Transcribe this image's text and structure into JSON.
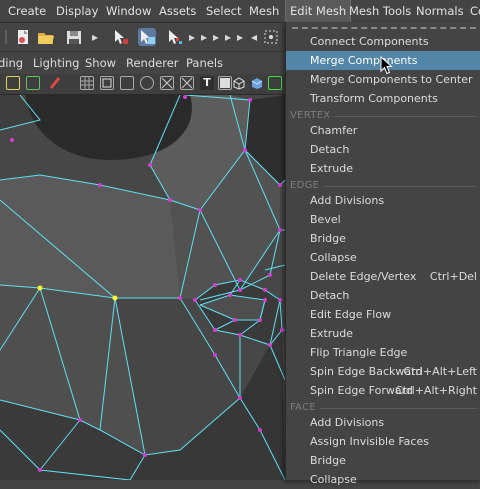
{
  "menubar": {
    "items": [
      "Create",
      "Display",
      "Window",
      "Assets",
      "Select",
      "Mesh",
      "Edit Mesh",
      "Mesh Tools",
      "Normals",
      "Co"
    ],
    "active": "Edit Mesh"
  },
  "panel_menu": [
    "ding",
    "Lighting",
    "Show",
    "Renderer",
    "Panels"
  ],
  "viewport_toolbar_text": "T",
  "dropdown": {
    "top_items": [
      "Connect Components",
      "Merge Components",
      "Merge Components to Center",
      "Transform Components"
    ],
    "highlighted": "Merge Components",
    "vertex_header": "VERTEX",
    "vertex_items": [
      "Chamfer",
      "Detach",
      "Extrude"
    ],
    "edge_header": "EDGE",
    "edge_items": [
      {
        "label": "Add Divisions",
        "shortcut": ""
      },
      {
        "label": "Bevel",
        "shortcut": ""
      },
      {
        "label": "Bridge",
        "shortcut": ""
      },
      {
        "label": "Collapse",
        "shortcut": ""
      },
      {
        "label": "Delete Edge/Vertex",
        "shortcut": "Ctrl+Del"
      },
      {
        "label": "Detach",
        "shortcut": ""
      },
      {
        "label": "Edit Edge Flow",
        "shortcut": ""
      },
      {
        "label": "Extrude",
        "shortcut": ""
      },
      {
        "label": "Flip Triangle Edge",
        "shortcut": ""
      },
      {
        "label": "Spin Edge Backward",
        "shortcut": "Ctrl+Alt+Left"
      },
      {
        "label": "Spin Edge Forward",
        "shortcut": "Ctrl+Alt+Right"
      }
    ],
    "face_header": "FACE",
    "face_items": [
      "Add Divisions",
      "Assign Invisible Faces",
      "Bridge",
      "Collapse"
    ]
  },
  "colors": {
    "ui_bg": "#444444",
    "highlight": "#5285a6",
    "wire": "#5fe0f0",
    "vertex": "#d040d0",
    "selected_vertex": "#ffff30",
    "mesh_dark": "#3a3a3a",
    "mesh_mid": "#5a5a5a"
  }
}
